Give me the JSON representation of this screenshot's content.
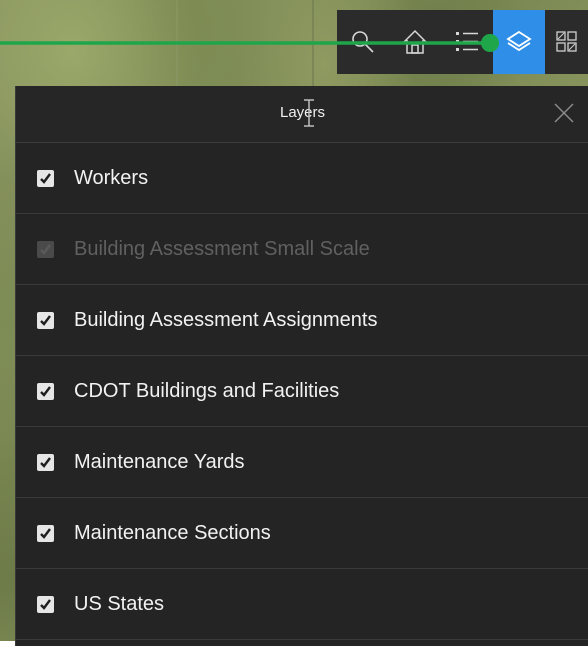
{
  "panel": {
    "title": "Layers",
    "close_icon": "close-icon"
  },
  "toolbar": {
    "buttons": [
      {
        "icon": "search-icon",
        "active": false
      },
      {
        "icon": "home-icon",
        "active": false
      },
      {
        "icon": "legend-icon",
        "active": false
      },
      {
        "icon": "layers-icon",
        "active": true
      },
      {
        "icon": "basemap-gallery-icon",
        "active": false
      }
    ]
  },
  "layers": [
    {
      "label": "Workers",
      "checked": true,
      "enabled": true
    },
    {
      "label": "Building Assessment Small Scale",
      "checked": true,
      "enabled": false
    },
    {
      "label": "Building Assessment Assignments",
      "checked": true,
      "enabled": true
    },
    {
      "label": "CDOT Buildings and Facilities",
      "checked": true,
      "enabled": true
    },
    {
      "label": "Maintenance Yards",
      "checked": true,
      "enabled": true
    },
    {
      "label": "Maintenance Sections",
      "checked": true,
      "enabled": true
    },
    {
      "label": "US States",
      "checked": true,
      "enabled": true
    }
  ],
  "colors": {
    "accent": "#2f8fe8",
    "annotation_line": "#1fa64a",
    "panel_bg": "#242424",
    "toolbar_bg": "#2b2b2b"
  }
}
